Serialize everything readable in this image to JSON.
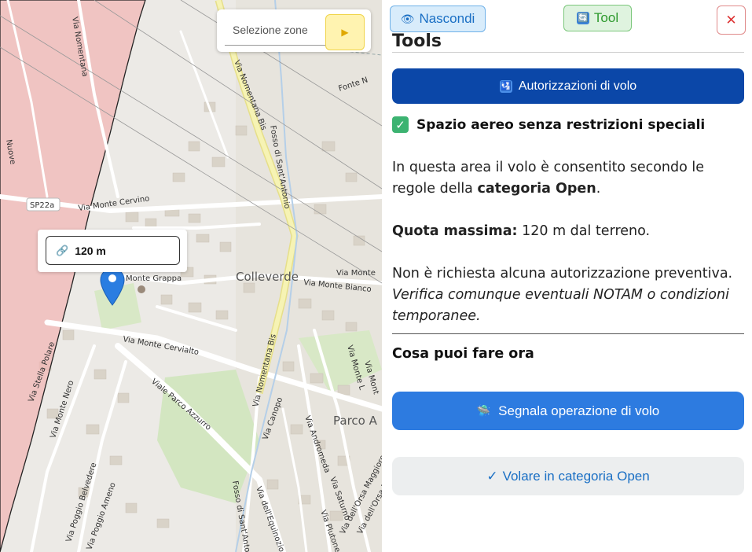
{
  "map": {
    "zone_select": {
      "placeholder": "Selezione zone",
      "button_icon": "play-icon",
      "button_glyph": "▶"
    },
    "altitude_popup": {
      "icon": "link-icon",
      "glyph": "🔗",
      "value": "120 m"
    },
    "labels": {
      "via_nomentana_top": "Via Nomentana",
      "via_nomentana_bis": "Via Nomentana Bis",
      "fosso_top": "Fosso di Sant'Antonio",
      "fonte_n": "Fonte N",
      "sp22a": "SP22a",
      "via_monte_cervino": "Via Monte Cervino",
      "via_monte_grappa": "Monte Grappa",
      "colleverde": "Colleverde",
      "via_monte_bianco": "Via Monte Bianco",
      "via_monte_cervialto": "Via Monte Cervialto",
      "viale_parco_azzurro": "Viale Parco Azzurro",
      "via_nomentana_lower": "Via Nomentana Bis",
      "via_stella_polare": "Via Stella Polare",
      "via_monte_nero": "Via Monte Nero",
      "parco_a": "Parco A",
      "via_canopo": "Via Canopo",
      "via_andromeda": "Via Andromeda",
      "via_saturno": "Via Saturno",
      "via_plutone": "Via Plutone",
      "via_equinozio": "Via dell'Equinozio",
      "fosso_bottom": "Fosso di Sant'Antonio",
      "via_orsa_maggiore": "Via dell'Orsa Maggiore",
      "via_orsa_minore": "Via dell'Orsa Mi",
      "via_poggio_belvedere": "Via Poggio Belvedere",
      "via_poggio_ameno": "Via Poggio Ameno",
      "via_monte_monte": "Via Monte",
      "via_monte_l": "Via Monte L",
      "via_montagna": "Via Mont",
      "mugnone": "Via Mugnone",
      "nuove": "Nuove"
    },
    "colors": {
      "restricted_zone": "#f2b7b5",
      "zone_border": "#222222",
      "marker": "#2a7de1",
      "road": "#ffffff",
      "main_road": "#f6f3b4"
    }
  },
  "panel": {
    "hide_button": {
      "icon": "eye-icon",
      "glyph": "👁",
      "label": "Nascondi"
    },
    "tool_button": {
      "icon": "refresh-icon",
      "glyph": "🔄",
      "label": "Tool"
    },
    "close_button": {
      "icon": "close-icon",
      "glyph": "✕"
    },
    "title": "Tools",
    "auth_button": {
      "icon": "flight-icon",
      "glyph": "🛂",
      "label": "Autorizzazioni di volo"
    },
    "status": {
      "icon": "check-icon",
      "glyph": "✓",
      "text": "Spazio aereo senza restrizioni speciali"
    },
    "p1": {
      "text1": "In questa area il volo è consentito secondo le regole della ",
      "bold": "categoria Open",
      "text2": "."
    },
    "p2": {
      "bold": "Quota massima:",
      "text": " 120 m dal terreno."
    },
    "p3": {
      "text": "Non è richiesta alcuna autorizzazione preventiva. ",
      "italic": "Verifica comunque eventuali NOTAM o condizioni temporanee."
    },
    "section_title": "Cosa puoi fare ora",
    "report_button": {
      "icon": "drone-icon",
      "glyph": "🛸",
      "label": "Segnala operazione di volo"
    },
    "open_button": {
      "icon": "checkmark-icon",
      "glyph": "✓",
      "label": "Volare in categoria Open"
    },
    "colors": {
      "primary_dark": "#0b47a8",
      "primary": "#2d7be0",
      "success": "#3cb371",
      "danger": "#dd3333"
    }
  }
}
